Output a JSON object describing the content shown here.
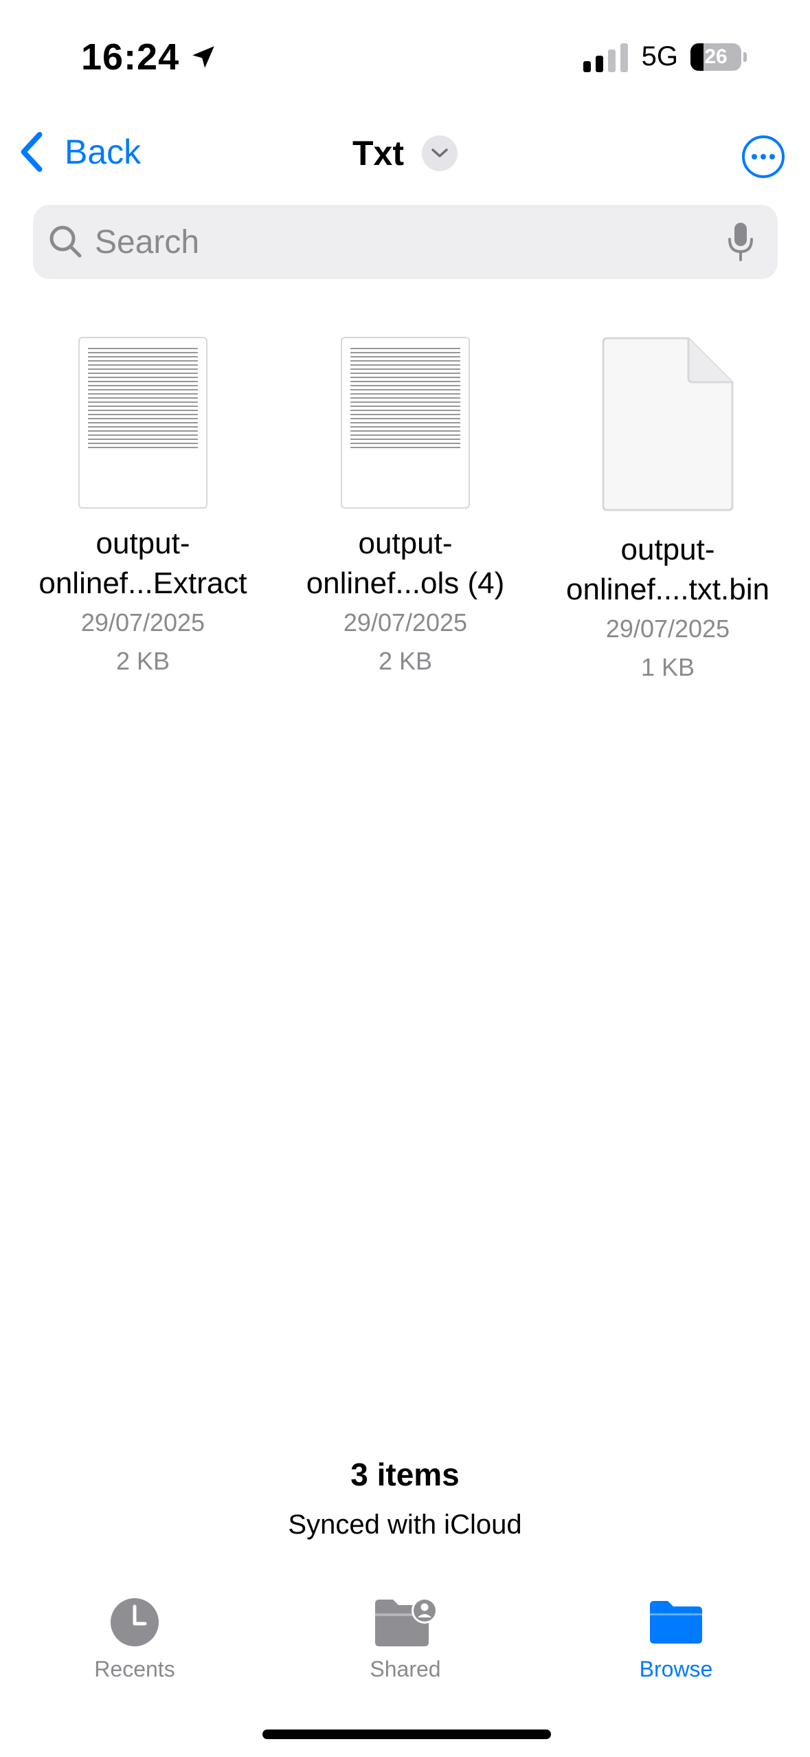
{
  "status_bar": {
    "time": "16:24",
    "location_icon": "location-arrow-icon",
    "network": "5G",
    "battery_level": "26",
    "signal_bars_active": 2,
    "signal_bars_total": 4
  },
  "nav": {
    "back_label": "Back",
    "title": "Txt",
    "title_chevron_icon": "chevron-down-icon",
    "more_icon": "ellipsis-circle-icon"
  },
  "search": {
    "placeholder": "Search",
    "search_icon": "search-icon",
    "mic_icon": "microphone-icon"
  },
  "files": [
    {
      "name_line1": "output-",
      "name_line2": "onlinef...Extract",
      "date": "29/07/2025",
      "size": "2 KB",
      "thumbnail": "text-preview"
    },
    {
      "name_line1": "output-",
      "name_line2": "onlinef...ols (4)",
      "date": "29/07/2025",
      "size": "2 KB",
      "thumbnail": "text-preview"
    },
    {
      "name_line1": "output-",
      "name_line2": "onlinef....txt.bin",
      "date": "29/07/2025",
      "size": "1 KB",
      "thumbnail": "blank-document"
    }
  ],
  "footer": {
    "count": "3 items",
    "sync_status": "Synced with iCloud"
  },
  "tabs": [
    {
      "label": "Recents",
      "icon": "clock-icon",
      "active": false
    },
    {
      "label": "Shared",
      "icon": "shared-folder-icon",
      "active": false
    },
    {
      "label": "Browse",
      "icon": "folder-icon",
      "active": true
    }
  ],
  "colors": {
    "accent": "#007aff",
    "secondary_text": "#8a8a8e",
    "search_background": "#eeeef0",
    "inactive_icon": "#8e8e93"
  }
}
